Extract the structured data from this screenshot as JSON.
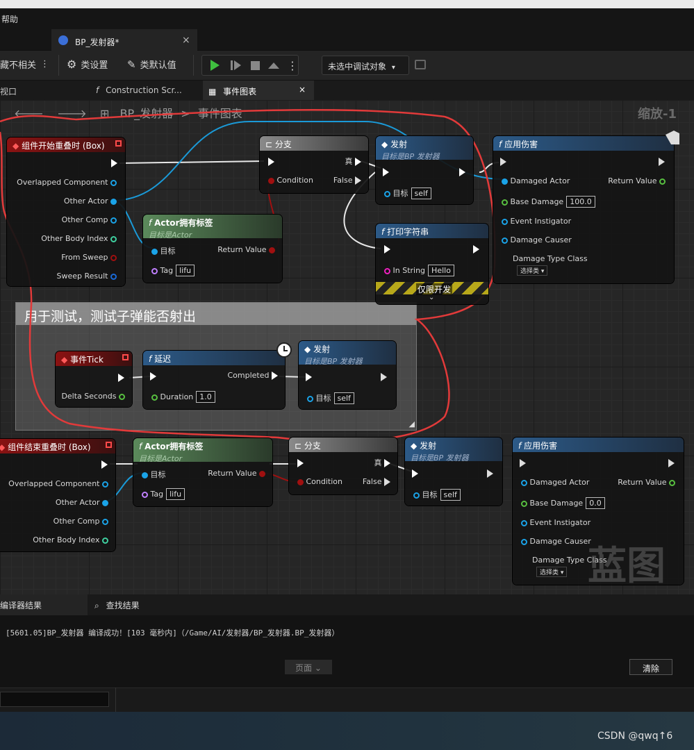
{
  "menubar": {
    "help": "帮助"
  },
  "doc_tab": {
    "title": "BP_发射器*",
    "close": "×"
  },
  "toolbar": {
    "hide_unrelated": "藏不相关",
    "class_settings": "类设置",
    "class_defaults": "类默认值",
    "debug_select": "未选中调试对象"
  },
  "subtabs": {
    "viewport": "视口",
    "construction": "Construction Scr...",
    "event_graph": "事件图表",
    "close": "×"
  },
  "breadcrumb": {
    "blueprint": "BP_发射器",
    "sep": ">",
    "graph": "事件图表"
  },
  "zoom": "缩放-1",
  "nodes": {
    "begin_overlap": {
      "title": "组件开始重叠时 (Box)",
      "pins": [
        "Overlapped Component",
        "Other Actor",
        "Other Comp",
        "Other Body Index",
        "From Sweep",
        "Sweep Result"
      ]
    },
    "branch1": {
      "title": "分支",
      "condition": "Condition",
      "true_label": "真",
      "false_label": "False"
    },
    "fire1": {
      "title": "发射",
      "subtitle": "目标是BP 发射器",
      "target": "目标",
      "target_val": "self"
    },
    "apply_damage1": {
      "title": "应用伤害",
      "damaged_actor": "Damaged Actor",
      "return_value": "Return Value",
      "base_damage": "Base Damage",
      "base_damage_val": "100.0",
      "event_instigator": "Event Instigator",
      "damage_causer": "Damage Causer",
      "damage_type": "Damage Type Class",
      "select_class": "选择类"
    },
    "has_tag1": {
      "title": "Actor拥有标签",
      "subtitle": "目标是Actor",
      "target": "目标",
      "return_value": "Return Value",
      "tag": "Tag",
      "tag_val": "lifu"
    },
    "print_string": {
      "title": "打印字符串",
      "in_string": "In String",
      "in_string_val": "Hello",
      "dev_only": "仅限开发"
    },
    "event_tick": {
      "title": "事件Tick",
      "delta": "Delta Seconds"
    },
    "delay": {
      "title": "延迟",
      "completed": "Completed",
      "duration": "Duration",
      "duration_val": "1.0"
    },
    "fire2": {
      "title": "发射",
      "subtitle": "目标是BP 发射器",
      "target": "目标",
      "target_val": "self"
    },
    "end_overlap": {
      "title": "组件结束重叠时 (Box)",
      "pins": [
        "Overlapped Component",
        "Other Actor",
        "Other Comp",
        "Other Body Index"
      ]
    },
    "has_tag2": {
      "title": "Actor拥有标签",
      "subtitle": "目标是Actor",
      "target": "目标",
      "return_value": "Return Value",
      "tag": "Tag",
      "tag_val": "lifu"
    },
    "branch2": {
      "title": "分支",
      "condition": "Condition",
      "true_label": "真",
      "false_label": "False"
    },
    "fire3": {
      "title": "发射",
      "subtitle": "目标是BP 发射器",
      "target": "目标",
      "target_val": "self"
    },
    "apply_damage2": {
      "title": "应用伤害",
      "damaged_actor": "Damaged Actor",
      "return_value": "Return Value",
      "base_damage": "Base Damage",
      "base_damage_val": "0.0",
      "event_instigator": "Event Instigator",
      "damage_causer": "Damage Causer",
      "damage_type": "Damage Type Class",
      "select_class": "选择类"
    }
  },
  "comment": "用于测试，测试子弹能否射出",
  "blueprint_mark": "蓝图",
  "bottom": {
    "compiler_tab": "编译器结果",
    "find_tab": "查找结果",
    "log": "[5601.05]BP_发射器 编译成功！[103 毫秒内]（/Game/AI/发射器/BP_发射器.BP_发射器）",
    "page": "页面",
    "clear": "清除"
  },
  "watermark": "CSDN @qwq↑6",
  "colors": {
    "object_pin": "#1aa3e8",
    "bool_pin": "#a01010",
    "float_pin": "#58c040",
    "name_pin": "#c080ff",
    "string_pin": "#f020c0",
    "red_annotation": "#e23a3a"
  }
}
